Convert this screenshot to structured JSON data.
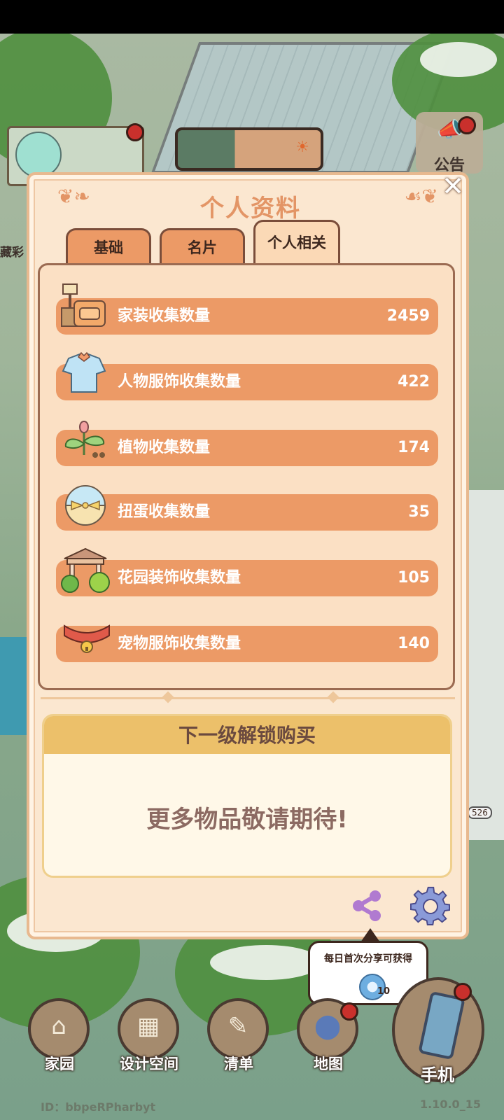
{
  "scene": {
    "notice_label": "公告",
    "side_label": "藏彩",
    "level_badge": "526"
  },
  "dialog": {
    "title": "个人资料",
    "tabs": [
      {
        "label": "基础",
        "active": false
      },
      {
        "label": "名片",
        "active": false
      },
      {
        "label": "个人相关",
        "active": true
      }
    ],
    "stats": [
      {
        "label": "家装收集数量",
        "value": "2459",
        "icon": "furniture-icon"
      },
      {
        "label": "人物服饰收集数量",
        "value": "422",
        "icon": "clothing-icon"
      },
      {
        "label": "植物收集数量",
        "value": "174",
        "icon": "plant-icon"
      },
      {
        "label": "扭蛋收集数量",
        "value": "35",
        "icon": "capsule-icon"
      },
      {
        "label": "花园装饰收集数量",
        "value": "105",
        "icon": "gazebo-icon"
      },
      {
        "label": "宠物服饰收集数量",
        "value": "140",
        "icon": "pet-collar-icon"
      }
    ],
    "unlock_header": "下一级解锁购买",
    "unlock_message": "更多物品敬请期待!"
  },
  "tooltip": {
    "text": "每日首次分享可获得",
    "reward_count": "10"
  },
  "nav": {
    "items": [
      {
        "label": "家园",
        "icon": "home-icon"
      },
      {
        "label": "设计空间",
        "icon": "design-icon"
      },
      {
        "label": "清单",
        "icon": "list-icon"
      },
      {
        "label": "地图",
        "icon": "map-pin-icon"
      }
    ],
    "phone_label": "手机"
  },
  "footer": {
    "user_id": "ID：bbpeRPharbyt",
    "version": "1.10.0_15"
  },
  "colors": {
    "accent": "#ec9a66",
    "panel": "#fbe7d0",
    "header_gold": "#ecc06a",
    "badge_red": "#c9302c"
  }
}
